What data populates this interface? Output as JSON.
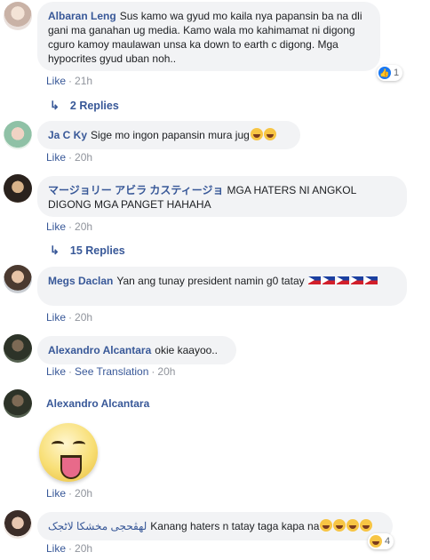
{
  "comments": [
    {
      "author": "Albaran Leng",
      "text": "Sus kamo wa gyud mo kaila nya papansin ba na dli gani ma ganahan ug media. Kamo wala mo kahimamat ni digong cguro kamoy maulawan unsa ka down to earth c digong. Mga hypocrites gyud uban noh..",
      "like_label": "Like",
      "time": "21h",
      "reaction_count": "1",
      "replies_label": "2 Replies"
    },
    {
      "author": "Ja C Ky",
      "text": "Sige mo ingon papansin mura jug",
      "like_label": "Like",
      "time": "20h"
    },
    {
      "author": "マージョリー アビラ カスティージョ",
      "text": "MGA HATERS NI ANGKOL DIGONG MGA PANGET HAHAHA",
      "like_label": "Like",
      "time": "20h",
      "replies_label": "15 Replies"
    },
    {
      "author": "Megs Daclan",
      "text": "Yan ang tunay president namin g0 tatay",
      "like_label": "Like",
      "time": "20h"
    },
    {
      "author": "Alexandro Alcantara",
      "text": "okie kaayoo..",
      "like_label": "Like",
      "translation_label": "See Translation",
      "time": "20h"
    },
    {
      "author": "Alexandro Alcantara",
      "like_label": "Like",
      "time": "20h"
    },
    {
      "author": "لهڤحجى مخشکا لاٹجک",
      "text": "Kanang haters n tatay taga kapa na",
      "like_label": "Like",
      "time": "20h",
      "reaction_count": "4"
    }
  ],
  "colors": {
    "link": "#385898",
    "bubble": "#f2f3f5",
    "meta": "#90949c"
  },
  "icons": [
    "reply-arrow-icon",
    "like-reaction-icon",
    "haha-emoji-icon",
    "philippine-flag-icon",
    "tongue-out-sticker"
  ]
}
